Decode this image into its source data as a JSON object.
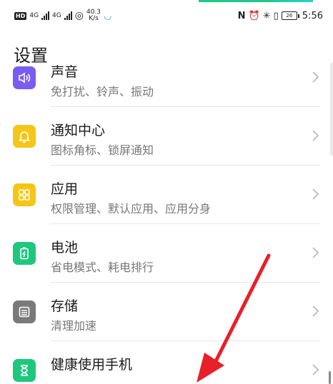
{
  "status_bar": {
    "hd": "HD",
    "net1": "4G",
    "net2": "4G",
    "speed_value": "40.3",
    "speed_unit": "K/s",
    "time": "5:56",
    "battery": "26"
  },
  "page": {
    "title": "设置"
  },
  "items": [
    {
      "title": "声音",
      "subtitle": "免打扰、铃声、振动",
      "icon": "sound-icon",
      "color": "#7b5cf0"
    },
    {
      "title": "通知中心",
      "subtitle": "图标角标、锁屏通知",
      "icon": "bell-icon",
      "color": "#f5c518"
    },
    {
      "title": "应用",
      "subtitle": "权限管理、默认应用、应用分身",
      "icon": "apps-grid-icon",
      "color": "#f5c518"
    },
    {
      "title": "电池",
      "subtitle": "省电模式、耗电排行",
      "icon": "battery-icon",
      "color": "#1fc77e"
    },
    {
      "title": "存储",
      "subtitle": "清理加速",
      "icon": "storage-icon",
      "color": "#7a7a7a"
    },
    {
      "title": "健康使用手机",
      "subtitle": "",
      "icon": "hourglass-icon",
      "color": "#1fc77e"
    }
  ],
  "colors": {
    "arrow": "#e8202a"
  }
}
